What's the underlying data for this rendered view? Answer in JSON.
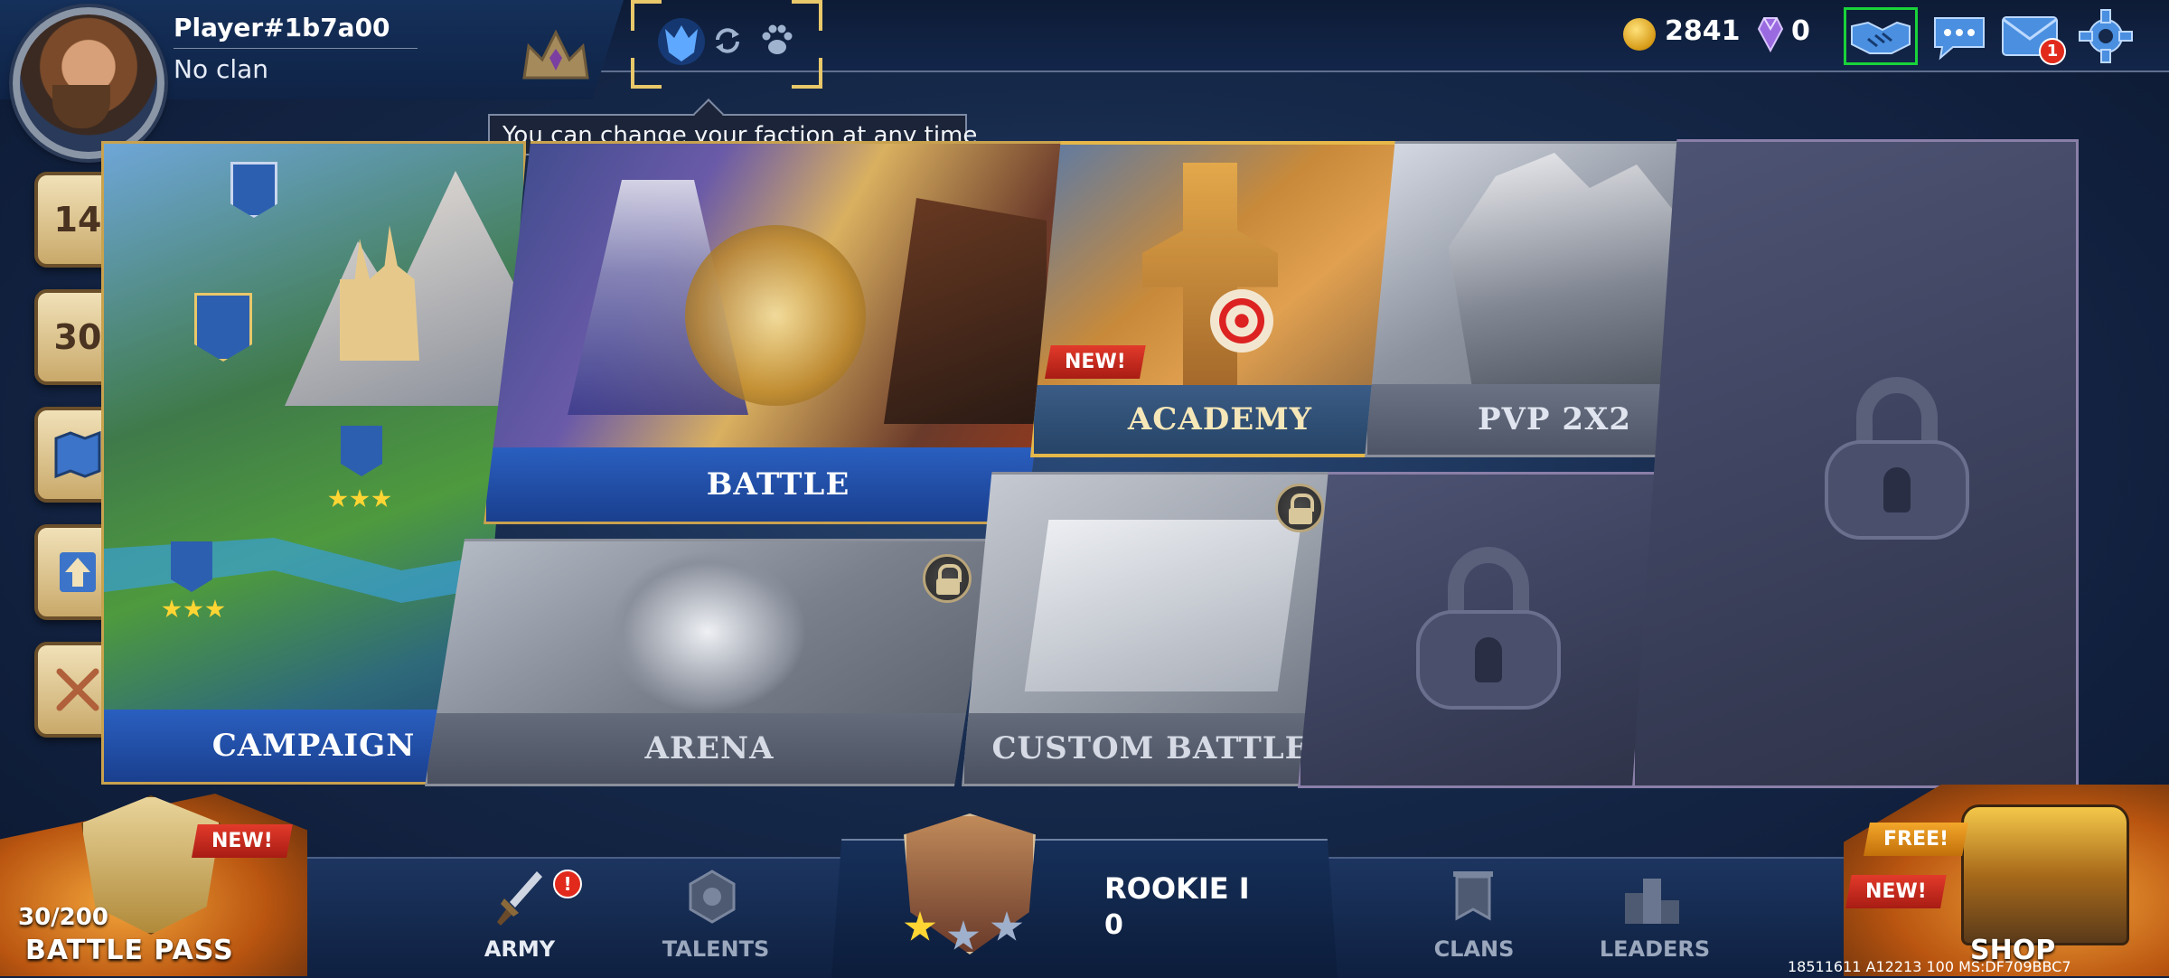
{
  "profile": {
    "name": "Player#1b7a00",
    "clan": "No clan"
  },
  "tooltip": {
    "text": "You can change your faction at any time"
  },
  "currency": {
    "gold": "2841",
    "gems": "0"
  },
  "mail": {
    "badge": "1"
  },
  "side_menu": {
    "level1": "14",
    "level2": "30"
  },
  "modes": {
    "campaign": "CAMPAIGN",
    "battle": "BATTLE",
    "academy": "ACADEMY",
    "academy_tag": "NEW!",
    "pvp": "PVP 2X2",
    "arena": "ARENA",
    "custom_battle": "CUSTOM BATTLE"
  },
  "battle_pass": {
    "progress": "30/200",
    "label": "BATTLE PASS",
    "tag": "NEW!"
  },
  "nav": {
    "army": "ARMY",
    "army_badge": "!",
    "talents": "TALENTS",
    "clans": "CLANS",
    "leaders": "LEADERS"
  },
  "rank": {
    "title": "ROOKIE I",
    "points": "0",
    "stars_filled": 1,
    "stars_total": 3
  },
  "shop": {
    "label": "SHOP",
    "free_tag": "FREE!",
    "new_tag": "NEW!"
  },
  "build_info": "18511611 A12213 100 MS:DF709BBC7",
  "colors": {
    "gold_accent": "#e9c86a",
    "battle_blue": "#1f4fa8",
    "friends_highlight": "#19d33a",
    "new_red": "#d62a1e"
  },
  "icons": [
    "handshake-icon",
    "chat-icon",
    "mail-icon",
    "gear-icon",
    "faction-wolf-icon",
    "swap-icon",
    "paw-icon",
    "coin-icon",
    "gem-icon",
    "lock-icon",
    "sword-icon"
  ]
}
